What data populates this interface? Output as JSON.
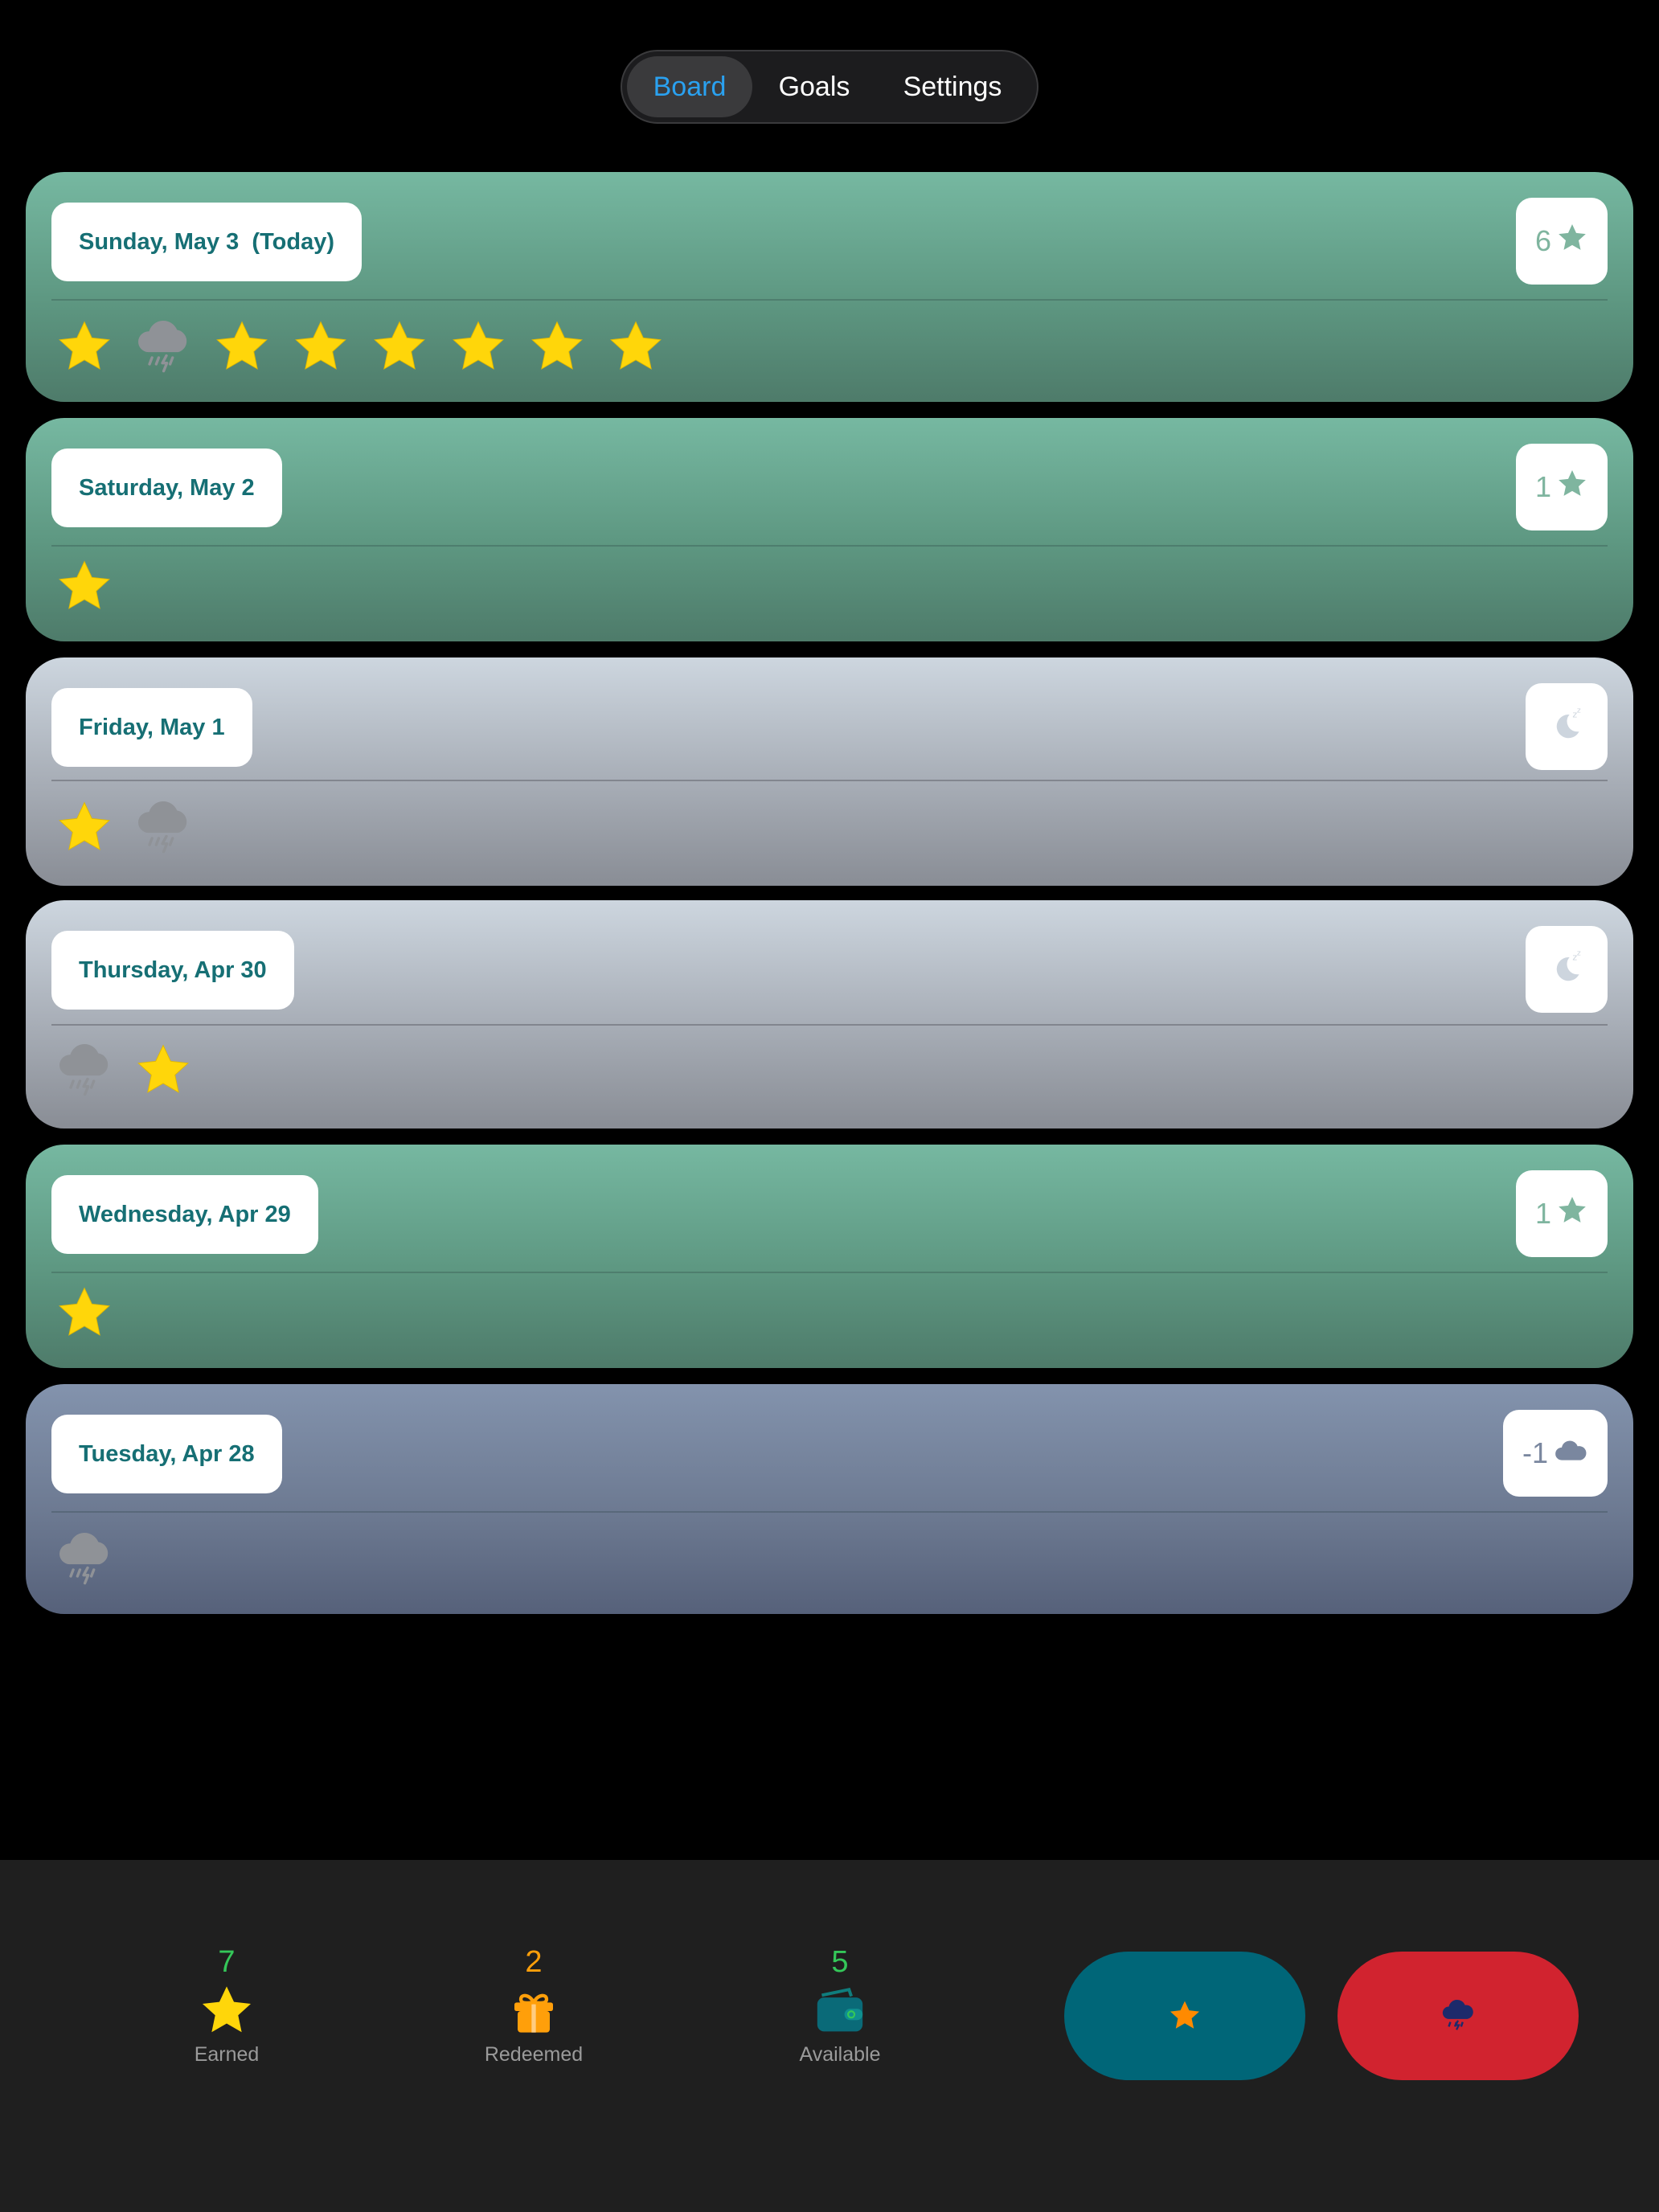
{
  "tabs": [
    {
      "label": "Board",
      "active": true
    },
    {
      "label": "Goals",
      "active": false
    },
    {
      "label": "Settings",
      "active": false
    }
  ],
  "days": [
    {
      "date": "Sunday, May 3  (Today)",
      "theme": "green",
      "badge_value": "6",
      "badge_icon": "star-icon",
      "icons": [
        "star",
        "storm",
        "star",
        "star",
        "star",
        "star",
        "star",
        "star"
      ]
    },
    {
      "date": "Saturday, May 2",
      "theme": "green",
      "badge_value": "1",
      "badge_icon": "star-icon",
      "icons": [
        "star"
      ]
    },
    {
      "date": "Friday, May 1",
      "theme": "gray",
      "badge_value": "",
      "badge_icon": "moon-sleep-icon",
      "icons": [
        "star",
        "storm"
      ]
    },
    {
      "date": "Thursday, Apr 30",
      "theme": "gray",
      "badge_value": "",
      "badge_icon": "moon-sleep-icon",
      "icons": [
        "storm",
        "star"
      ]
    },
    {
      "date": "Wednesday, Apr 29",
      "theme": "green",
      "badge_value": "1",
      "badge_icon": "star-icon",
      "icons": [
        "star"
      ]
    },
    {
      "date": "Tuesday, Apr 28",
      "theme": "blue",
      "badge_value": "-1",
      "badge_icon": "cloud-icon",
      "icons": [
        "storm"
      ]
    }
  ],
  "stats": {
    "earned": {
      "value": "7",
      "label": "Earned",
      "color": "#34c759"
    },
    "redeemed": {
      "value": "2",
      "label": "Redeemed",
      "color": "#ff9f0a"
    },
    "available": {
      "value": "5",
      "label": "Available",
      "color": "#34c759"
    }
  },
  "colors": {
    "accent_tab": "#2aa1f0",
    "star_button": "#006678",
    "storm_button": "#d1232f",
    "date_text": "#166f74"
  }
}
